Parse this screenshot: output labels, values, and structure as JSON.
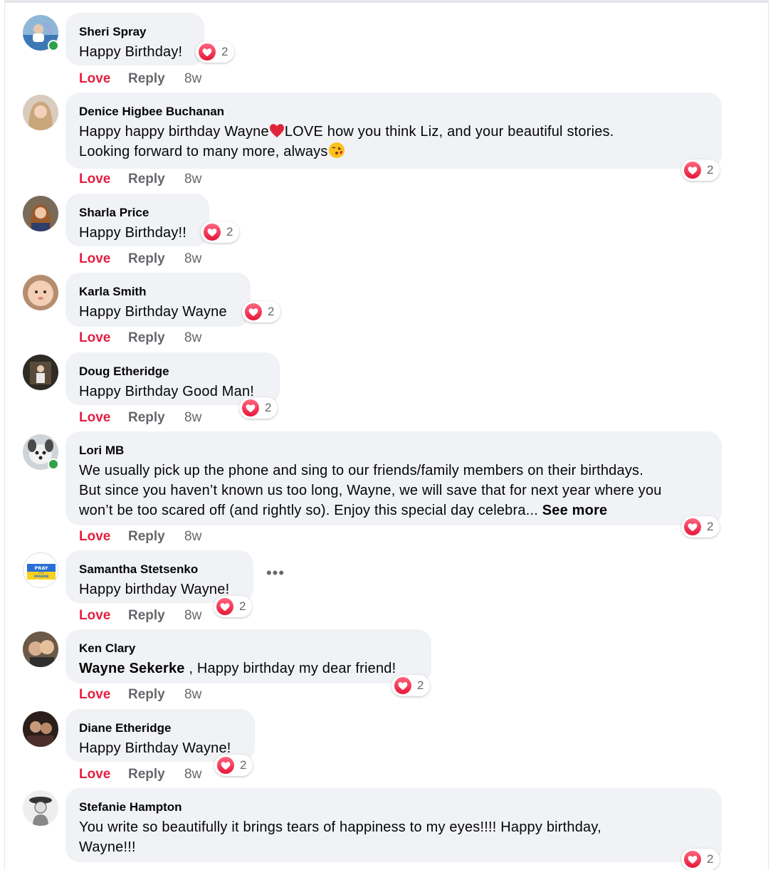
{
  "comments": [
    {
      "name": "Sheri Spray",
      "lines": [
        "Happy Birthday!"
      ],
      "reaction_count": "2",
      "love": "Love",
      "reply": "Reply",
      "time": "8w",
      "online": true
    },
    {
      "name": "Denice Higbee Buchanan",
      "line1_a": "Happy happy birthday Wayne",
      "line1_b": "LOVE how you think Liz, and your beautiful stories.",
      "line2": "Looking forward to many more, always",
      "reaction_count": "2",
      "love": "Love",
      "reply": "Reply",
      "time": "8w"
    },
    {
      "name": "Sharla Price",
      "lines": [
        "Happy Birthday!!"
      ],
      "reaction_count": "2",
      "love": "Love",
      "reply": "Reply",
      "time": "8w"
    },
    {
      "name": "Karla Smith",
      "lines": [
        "Happy Birthday Wayne"
      ],
      "reaction_count": "2",
      "love": "Love",
      "reply": "Reply",
      "time": "8w"
    },
    {
      "name": "Doug Etheridge",
      "lines": [
        "Happy Birthday Good Man!"
      ],
      "reaction_count": "2",
      "love": "Love",
      "reply": "Reply",
      "time": "8w"
    },
    {
      "name": "Lori MB",
      "lines": [
        "We usually pick up the phone and sing to our friends/family members on their birthdays.",
        "But since you haven’t known us too long, Wayne, we will save that for next year where you",
        "won’t be too scared off (and rightly so). Enjoy this special day celebra..."
      ],
      "see_more": "See more",
      "reaction_count": "2",
      "love": "Love",
      "reply": "Reply",
      "time": "8w",
      "online": true
    },
    {
      "name": "Samantha Stetsenko",
      "lines": [
        "Happy birthday Wayne!"
      ],
      "reaction_count": "2",
      "love": "Love",
      "reply": "Reply",
      "time": "8w",
      "avatar_text_1": "PRAY",
      "avatar_text_2": "FOR",
      "avatar_text_3": "UKRAINE",
      "more": "•••"
    },
    {
      "name": "Ken Clary",
      "mention": "Wayne Sekerke",
      "rest": " , Happy birthday my dear friend!",
      "reaction_count": "2",
      "love": "Love",
      "reply": "Reply",
      "time": "8w"
    },
    {
      "name": "Diane Etheridge",
      "lines": [
        "Happy Birthday Wayne!"
      ],
      "reaction_count": "2",
      "love": "Love",
      "reply": "Reply",
      "time": "8w"
    },
    {
      "name": "Stefanie Hampton",
      "lines": [
        "You write so beautifully it brings tears of happiness to my eyes!!!! Happy birthday,",
        "Wayne!!!"
      ],
      "reaction_count": "2"
    }
  ],
  "colors": {
    "love": "#e41e3f",
    "bubble": "#f0f2f5",
    "meta": "#65676b",
    "online": "#31a24c"
  }
}
